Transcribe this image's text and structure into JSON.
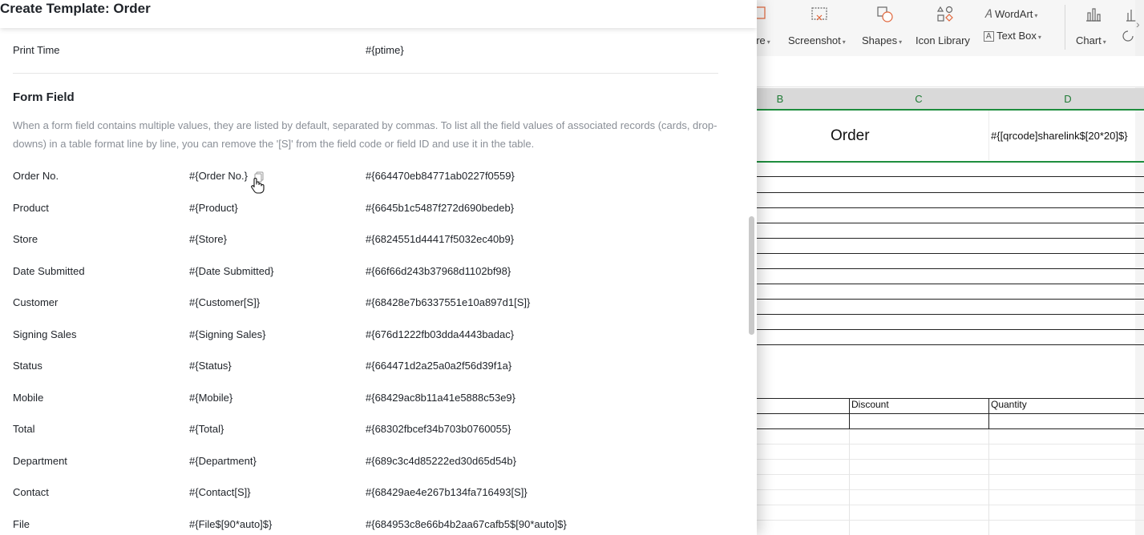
{
  "dialog": {
    "title": "Create Template: Order",
    "print_time": {
      "name": "Print Time",
      "id": "#{ptime}"
    },
    "form_field": {
      "title": "Form Field",
      "description": "When a form field contains multiple values, they are listed by default, separated by commas. To list all the field values of associated records (cards, drop-downs) in a table format line by line, you can remove the '[S]' from the field code or field ID and use it in the table.",
      "rows": [
        {
          "name": "Order No.",
          "code": "#{Order No.}",
          "id": "#{664470eb84771ab0227f0559}"
        },
        {
          "name": "Product",
          "code": "#{Product}",
          "id": "#{6645b1c5487f272d690bedeb}"
        },
        {
          "name": "Store",
          "code": "#{Store}",
          "id": "#{6824551d44417f5032ec40b9}"
        },
        {
          "name": "Date Submitted",
          "code": "#{Date Submitted}",
          "id": "#{66f66d243b37968d1102bf98}"
        },
        {
          "name": "Customer",
          "code": "#{Customer[S]}",
          "id": "#{68428e7b6337551e10a897d1[S]}"
        },
        {
          "name": "Signing Sales",
          "code": "#{Signing Sales}",
          "id": "#{676d1222fb03dda4443badac}"
        },
        {
          "name": "Status",
          "code": "#{Status}",
          "id": "#{664471d2a25a0a2f56d39f1a}"
        },
        {
          "name": "Mobile",
          "code": "#{Mobile}",
          "id": "#{68429ac8b11a41e5888c53e9}"
        },
        {
          "name": "Total",
          "code": "#{Total}",
          "id": "#{68302fbcef34b703b0760055}"
        },
        {
          "name": "Department",
          "code": "#{Department}",
          "id": "#{689c3c4d85222ed30d65d54b}"
        },
        {
          "name": "Contact",
          "code": "#{Contact[S]}",
          "id": "#{68429ae4e267b134fa716493[S]}"
        },
        {
          "name": "File",
          "code": "#{File$[90*auto]$}",
          "id": "#{684953c8e66b4b2aa67cafb5$[90*auto]$}"
        }
      ]
    }
  },
  "ribbon": {
    "partial_label": "ure",
    "screenshot": "Screenshot",
    "shapes": "Shapes",
    "icon_library": "Icon Library",
    "wordart": "WordArt",
    "text_box": "Text Box",
    "chart": "Chart",
    "accent_color": "#e0653a"
  },
  "sheet": {
    "columns": [
      "B",
      "C",
      "D"
    ],
    "order_title": "Order",
    "qr_code": "#{[qrcode]sharelink$[20*20]$}",
    "table_headers": [
      "Discount",
      "Quantity"
    ],
    "accent_color": "#1e8e3e"
  }
}
